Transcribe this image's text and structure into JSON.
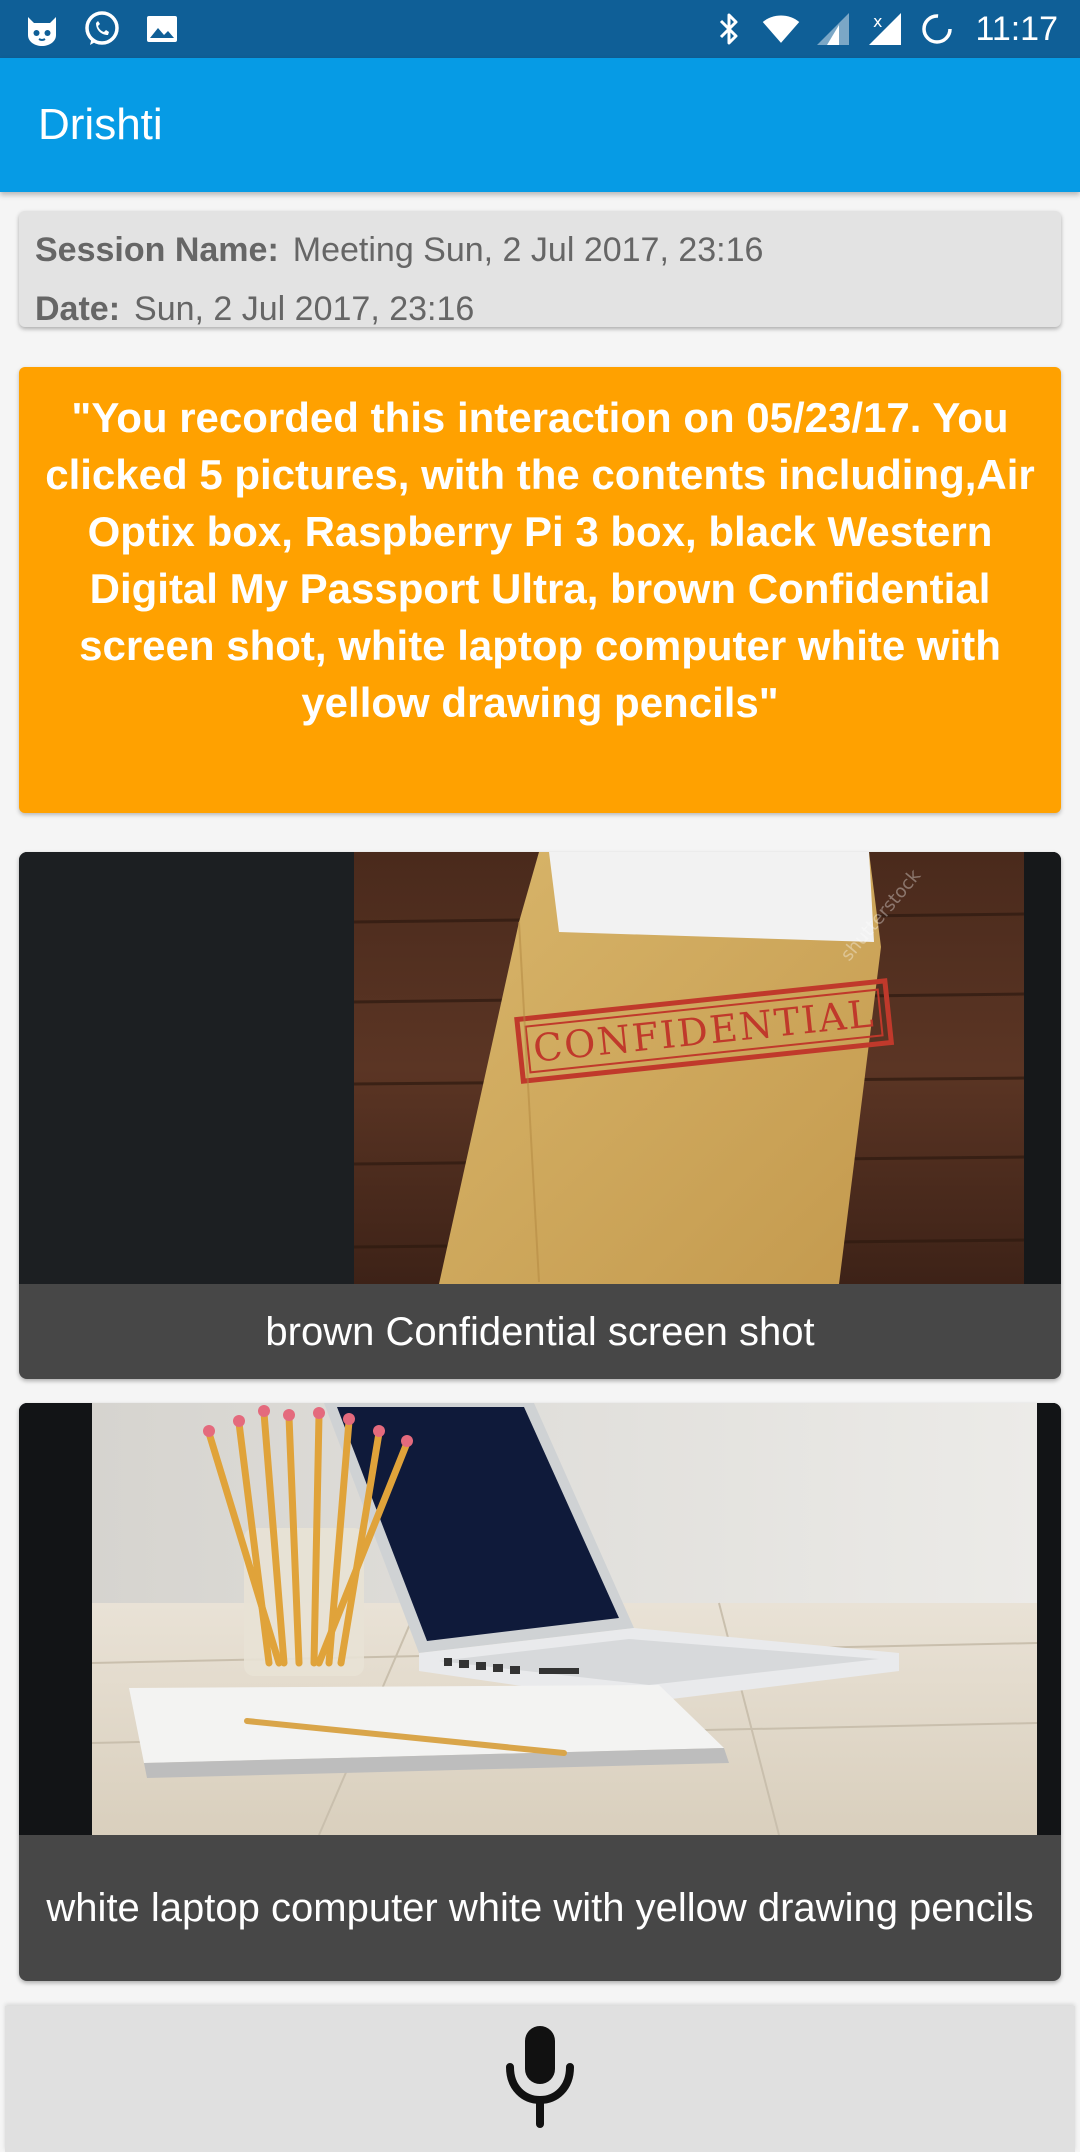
{
  "status_bar": {
    "time": "11:17",
    "left_icons": [
      "cat-notification-icon",
      "whatsapp-icon",
      "gallery-icon"
    ],
    "right_icons": [
      "bluetooth-icon",
      "wifi-icon",
      "signal-icon",
      "signal-no-sim-icon",
      "battery-charging-icon"
    ]
  },
  "app_bar": {
    "title": "Drishti"
  },
  "session": {
    "name_label": "Session Name:",
    "name_value": "Meeting Sun, 2 Jul 2017, 23:16",
    "date_label": "Date:",
    "date_value": "Sun, 2 Jul 2017, 23:16"
  },
  "summary": {
    "text": "\"You recorded this interaction on 05/23/17. You clicked 5 pictures, with the contents including,Air Optix box, Raspberry Pi 3 box, black Western Digital My Passport Ultra, brown Confidential screen shot, white laptop computer white with yellow drawing pencils\""
  },
  "photos": [
    {
      "caption": "brown Confidential screen shot",
      "stamp_text": "CONFIDENTIAL",
      "watermark": "shutterstock"
    },
    {
      "caption": "white laptop computer white with yellow drawing pencils"
    }
  ],
  "bottom_bar": {
    "icon": "microphone-icon"
  },
  "colors": {
    "status_bar": "#0f5f97",
    "app_bar": "#069be5",
    "summary_card": "#ffa100",
    "caption_bg": "#474747"
  }
}
